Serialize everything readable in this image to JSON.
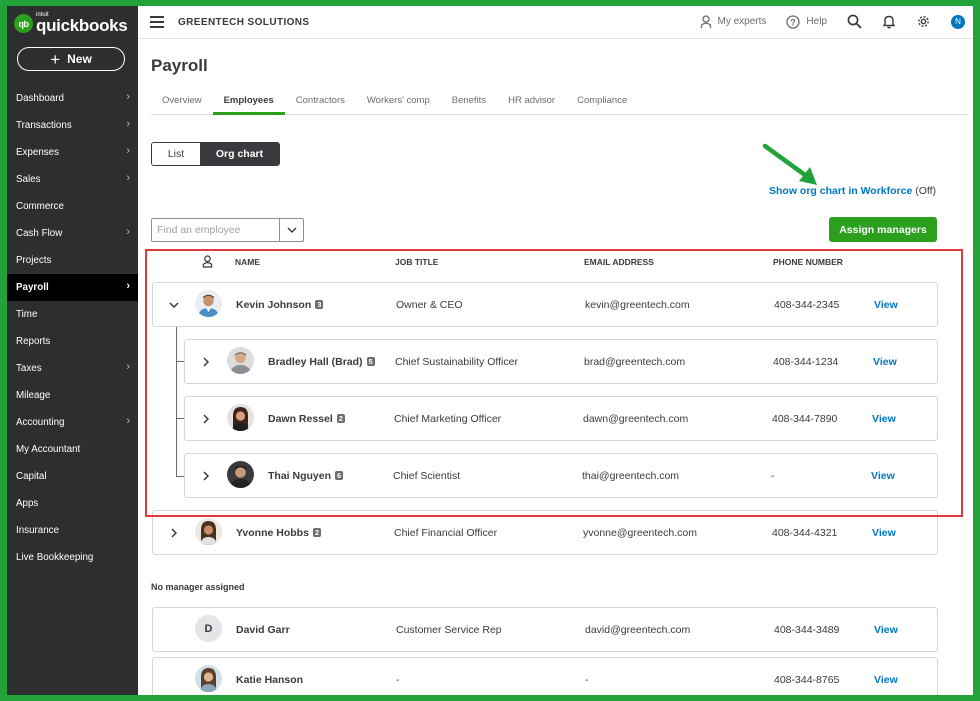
{
  "brand": {
    "logo_mark": "qb",
    "logo_small": "intuit",
    "logo_name": "quickbooks"
  },
  "new_button": {
    "label": "New"
  },
  "nav": [
    {
      "label": "Dashboard",
      "chevron": true
    },
    {
      "label": "Transactions",
      "chevron": true
    },
    {
      "label": "Expenses",
      "chevron": true
    },
    {
      "label": "Sales",
      "chevron": true
    },
    {
      "label": "Commerce",
      "chevron": false
    },
    {
      "label": "Cash Flow",
      "chevron": true
    },
    {
      "label": "Projects",
      "chevron": false
    },
    {
      "label": "Payroll",
      "chevron": true,
      "active": true
    },
    {
      "label": "Time",
      "chevron": false
    },
    {
      "label": "Reports",
      "chevron": false
    },
    {
      "label": "Taxes",
      "chevron": true
    },
    {
      "label": "Mileage",
      "chevron": false
    },
    {
      "label": "Accounting",
      "chevron": true
    },
    {
      "label": "My Accountant",
      "chevron": false
    },
    {
      "label": "Capital",
      "chevron": false
    },
    {
      "label": "Apps",
      "chevron": false
    },
    {
      "label": "Insurance",
      "chevron": false
    },
    {
      "label": "Live Bookkeeping",
      "chevron": false
    }
  ],
  "topbar": {
    "company": "GREENTECH SOLUTIONS",
    "my_experts": "My experts",
    "help": "Help",
    "avatar_initial": "N"
  },
  "page": {
    "title": "Payroll"
  },
  "tabs": [
    {
      "label": "Overview"
    },
    {
      "label": "Employees",
      "active": true
    },
    {
      "label": "Contractors"
    },
    {
      "label": "Workers' comp"
    },
    {
      "label": "Benefits"
    },
    {
      "label": "HR advisor"
    },
    {
      "label": "Compliance"
    }
  ],
  "view_toggle": {
    "list": "List",
    "org_chart": "Org chart",
    "selected": "Org chart"
  },
  "workforce_link": {
    "label": "Show org chart in Workforce",
    "status": "(Off)"
  },
  "search": {
    "placeholder": "Find an employee",
    "value": ""
  },
  "assign_button": {
    "label": "Assign managers"
  },
  "table": {
    "headers": {
      "name": "NAME",
      "job_title": "JOB TITLE",
      "email": "EMAIL ADDRESS",
      "phone": "PHONE NUMBER"
    },
    "view_label": "View",
    "rows": [
      {
        "name": "Kevin Johnson",
        "count": "3",
        "title": "Owner & CEO",
        "email": "kevin@greentech.com",
        "phone": "408-344-2345",
        "expanded": true
      },
      {
        "name": "Bradley Hall (Brad)",
        "count": "5",
        "title": "Chief Sustainability Officer",
        "email": "brad@greentech.com",
        "phone": "408-344-1234"
      },
      {
        "name": "Dawn Ressel",
        "count": "2",
        "title": "Chief Marketing Officer",
        "email": "dawn@greentech.com",
        "phone": "408-344-7890"
      },
      {
        "name": "Thai Nguyen",
        "count": "6",
        "title": "Chief Scientist",
        "email": "thai@greentech.com",
        "phone": "-"
      },
      {
        "name": "Yvonne Hobbs",
        "count": "2",
        "title": "Chief Financial Officer",
        "email": "yvonne@greentech.com",
        "phone": "408-344-4321"
      }
    ]
  },
  "no_manager": {
    "label": "No manager assigned",
    "rows": [
      {
        "initial": "D",
        "name": "David Garr",
        "title": "Customer Service Rep",
        "email": "david@greentech.com",
        "phone": "408-344-3489"
      },
      {
        "name": "Katie Hanson",
        "title": "-",
        "email": "-",
        "phone": "408-344-8765"
      }
    ]
  },
  "colors": {
    "brand_green": "#2ca01c",
    "link_blue": "#0077c5",
    "sidebar": "#2d2e30",
    "highlight_red": "#e0393e",
    "frame_green": "#22a33a"
  }
}
